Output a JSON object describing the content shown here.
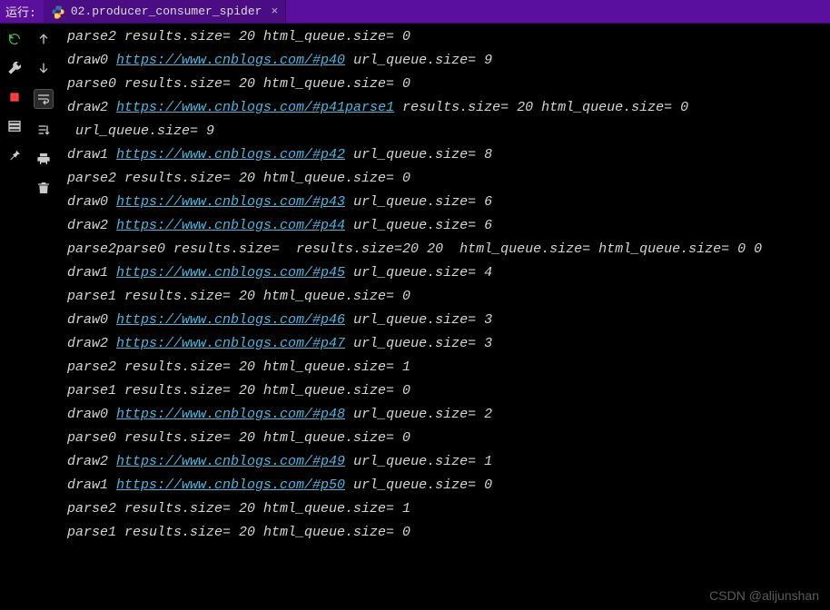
{
  "titlebar": {
    "run_label": "运行:",
    "tab_name": "02.producer_consumer_spider",
    "close_glyph": "×"
  },
  "watermark": "CSDN @alijunshan",
  "console_lines": [
    [
      {
        "t": "text",
        "v": "parse2 results.size= 20 html_queue.size= 0"
      }
    ],
    [
      {
        "t": "text",
        "v": "draw0 "
      },
      {
        "t": "link",
        "v": "https://www.cnblogs.com/#p40"
      },
      {
        "t": "text",
        "v": " url_queue.size= 9"
      }
    ],
    [
      {
        "t": "text",
        "v": "parse0 results.size= 20 html_queue.size= 0"
      }
    ],
    [
      {
        "t": "text",
        "v": "draw2 "
      },
      {
        "t": "link",
        "v": "https://www.cnblogs.com/#p41parse1"
      },
      {
        "t": "text",
        "v": " results.size= 20 html_queue.size= 0"
      }
    ],
    [
      {
        "t": "text",
        "v": " url_queue.size= 9"
      }
    ],
    [
      {
        "t": "text",
        "v": "draw1 "
      },
      {
        "t": "link",
        "v": "https://www.cnblogs.com/#p42"
      },
      {
        "t": "text",
        "v": " url_queue.size= 8"
      }
    ],
    [
      {
        "t": "text",
        "v": "parse2 results.size= 20 html_queue.size= 0"
      }
    ],
    [
      {
        "t": "text",
        "v": "draw0 "
      },
      {
        "t": "link",
        "v": "https://www.cnblogs.com/#p43"
      },
      {
        "t": "text",
        "v": " url_queue.size= 6"
      }
    ],
    [
      {
        "t": "text",
        "v": "draw2 "
      },
      {
        "t": "link",
        "v": "https://www.cnblogs.com/#p44"
      },
      {
        "t": "text",
        "v": " url_queue.size= 6"
      }
    ],
    [
      {
        "t": "text",
        "v": "parse2parse0 results.size=  results.size=20 20  html_queue.size= html_queue.size= 0 0"
      }
    ],
    [
      {
        "t": "text",
        "v": "draw1 "
      },
      {
        "t": "link",
        "v": "https://www.cnblogs.com/#p45"
      },
      {
        "t": "text",
        "v": " url_queue.size= 4"
      }
    ],
    [
      {
        "t": "text",
        "v": "parse1 results.size= 20 html_queue.size= 0"
      }
    ],
    [
      {
        "t": "text",
        "v": "draw0 "
      },
      {
        "t": "link",
        "v": "https://www.cnblogs.com/#p46"
      },
      {
        "t": "text",
        "v": " url_queue.size= 3"
      }
    ],
    [
      {
        "t": "text",
        "v": "draw2 "
      },
      {
        "t": "link",
        "v": "https://www.cnblogs.com/#p47"
      },
      {
        "t": "text",
        "v": " url_queue.size= 3"
      }
    ],
    [
      {
        "t": "text",
        "v": "parse2 results.size= 20 html_queue.size= 1"
      }
    ],
    [
      {
        "t": "text",
        "v": "parse1 results.size= 20 html_queue.size= 0"
      }
    ],
    [
      {
        "t": "text",
        "v": "draw0 "
      },
      {
        "t": "link",
        "v": "https://www.cnblogs.com/#p48"
      },
      {
        "t": "text",
        "v": " url_queue.size= 2"
      }
    ],
    [
      {
        "t": "text",
        "v": "parse0 results.size= 20 html_queue.size= 0"
      }
    ],
    [
      {
        "t": "text",
        "v": "draw2 "
      },
      {
        "t": "link",
        "v": "https://www.cnblogs.com/#p49"
      },
      {
        "t": "text",
        "v": " url_queue.size= 1"
      }
    ],
    [
      {
        "t": "text",
        "v": "draw1 "
      },
      {
        "t": "link",
        "v": "https://www.cnblogs.com/#p50"
      },
      {
        "t": "text",
        "v": " url_queue.size= 0"
      }
    ],
    [
      {
        "t": "text",
        "v": "parse2 results.size= 20 html_queue.size= 1"
      }
    ],
    [
      {
        "t": "text",
        "v": "parse1 results.size= 20 html_queue.size= 0"
      }
    ]
  ]
}
